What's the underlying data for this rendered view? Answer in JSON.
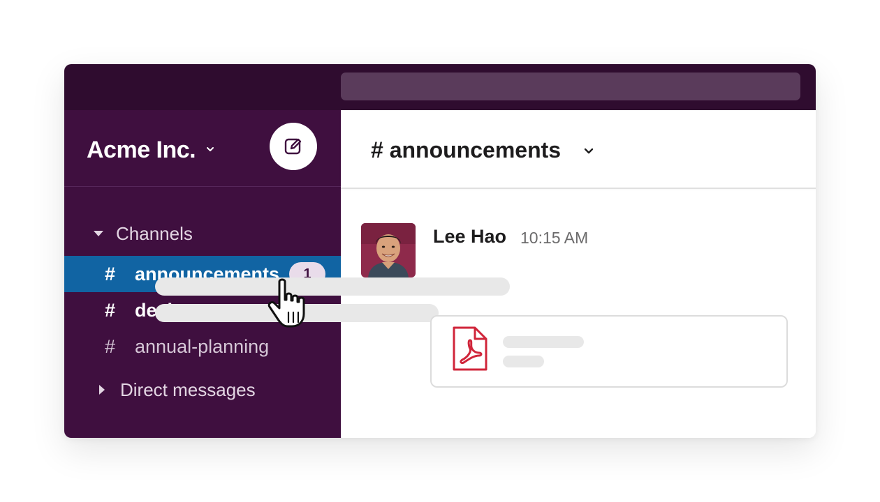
{
  "workspace": {
    "name": "Acme Inc.",
    "compose_icon": "compose-icon"
  },
  "sidebar": {
    "channels_section_label": "Channels",
    "channels": [
      {
        "name": "announcements",
        "prefix": "#",
        "state": "selected",
        "unread_count": "1"
      },
      {
        "name": "design-team",
        "prefix": "#",
        "state": "unread"
      },
      {
        "name": "annual-planning",
        "prefix": "#",
        "state": "read"
      }
    ],
    "dm_section_label": "Direct messages"
  },
  "channel_header": {
    "title": "# announcements"
  },
  "message": {
    "author": "Lee Hao",
    "timestamp": "10:15 AM",
    "attachment_icon": "pdf-file-icon"
  },
  "colors": {
    "topbar": "#2f0c2f",
    "search": "#5a3b5b",
    "sidebar": "#3f0f3f",
    "selected": "#1164a3",
    "badge": "#e9dcea",
    "pdf": "#d0253a"
  }
}
